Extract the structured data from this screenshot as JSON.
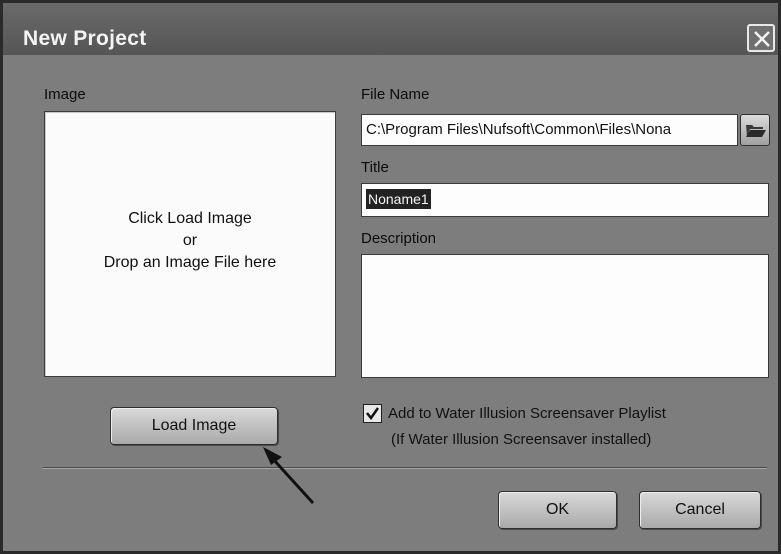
{
  "window": {
    "title": "New Project",
    "close_icon": "close-icon"
  },
  "image_section": {
    "label": "Image",
    "hint_line1": "Click Load Image",
    "hint_line2": "or",
    "hint_line3": "Drop an Image File here",
    "load_button": "Load Image"
  },
  "file_name": {
    "label": "File Name",
    "value": "C:\\Program Files\\Nufsoft\\Common\\Files\\Nona",
    "browse_icon": "folder-open-icon"
  },
  "title_field": {
    "label": "Title",
    "value": "Noname1"
  },
  "description": {
    "label": "Description",
    "value": ""
  },
  "playlist": {
    "checked": true,
    "label": "Add to Water Illusion Screensaver Playlist",
    "note": "(If Water Illusion Screensaver installed)"
  },
  "buttons": {
    "ok": "OK",
    "cancel": "Cancel"
  },
  "annotation": {
    "arrow_icon": "pointer-arrow-icon"
  }
}
